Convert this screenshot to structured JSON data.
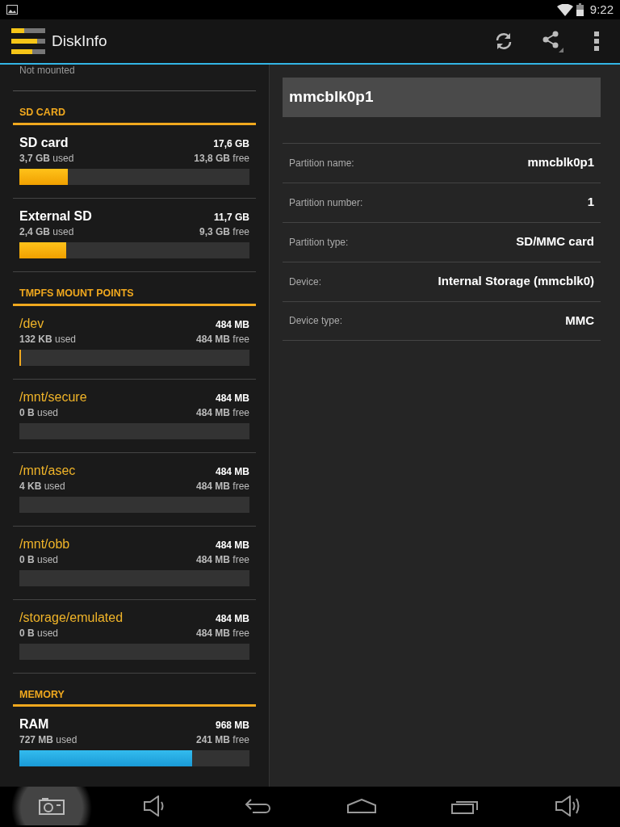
{
  "status_bar": {
    "time": "9:22"
  },
  "action_bar": {
    "title": "DiskInfo"
  },
  "left_list": {
    "partial_text": "Not mounted",
    "sections": [
      {
        "kind": "storage",
        "title": "SD CARD",
        "entries": [
          {
            "name": "SD card",
            "total": "17,6 GB",
            "used": "**3,7 GB** used",
            "free": "**13,8 GB** free",
            "level": 0.21
          },
          {
            "name": "External SD",
            "total": "11,7 GB",
            "used": "**2,4 GB** used",
            "free": "**9,3 GB** free",
            "level": 0.205
          }
        ]
      },
      {
        "kind": "mount",
        "title": "TMPFS MOUNT POINTS",
        "entries": [
          {
            "name": "/dev",
            "total": "484 MB",
            "used": "**132 KB** used",
            "free": "**484 MB** free",
            "level": 0.003
          },
          {
            "name": "/mnt/secure",
            "total": "484 MB",
            "used": "**0 B** used",
            "free": "**484 MB** free",
            "level": 0
          },
          {
            "name": "/mnt/asec",
            "total": "484 MB",
            "used": "**4 KB** used",
            "free": "**484 MB** free",
            "level": 0
          },
          {
            "name": "/mnt/obb",
            "total": "484 MB",
            "used": "**0 B** used",
            "free": "**484 MB** free",
            "level": 0
          },
          {
            "name": "/storage/emulated",
            "total": "484 MB",
            "used": "**0 B** used",
            "free": "**484 MB** free",
            "level": 0
          }
        ]
      },
      {
        "kind": "memory",
        "title": "MEMORY",
        "entries": [
          {
            "name": "RAM",
            "total": "968 MB",
            "used": "**727 MB** used",
            "free": "**241 MB** free",
            "level": 0.75
          }
        ]
      }
    ]
  },
  "detail": {
    "title": "mmcblk0p1",
    "rows": [
      {
        "label": "Partition name:",
        "value": "mmcblk0p1"
      },
      {
        "label": "Partition number:",
        "value": "1"
      },
      {
        "label": "Partition type:",
        "value": "SD/MMC card"
      },
      {
        "label": "Device:",
        "value": "Internal Storage (mmcblk0)"
      },
      {
        "label": "Device type:",
        "value": "MMC"
      }
    ]
  },
  "nav_bar": {
    "buttons": [
      {
        "kind": "screenshot",
        "selected": true
      },
      {
        "kind": "volume_down",
        "selected": false
      },
      {
        "kind": "back",
        "selected": false
      },
      {
        "kind": "home",
        "selected": false
      },
      {
        "kind": "recents",
        "selected": false
      },
      {
        "kind": "volume_up",
        "selected": false
      }
    ]
  }
}
